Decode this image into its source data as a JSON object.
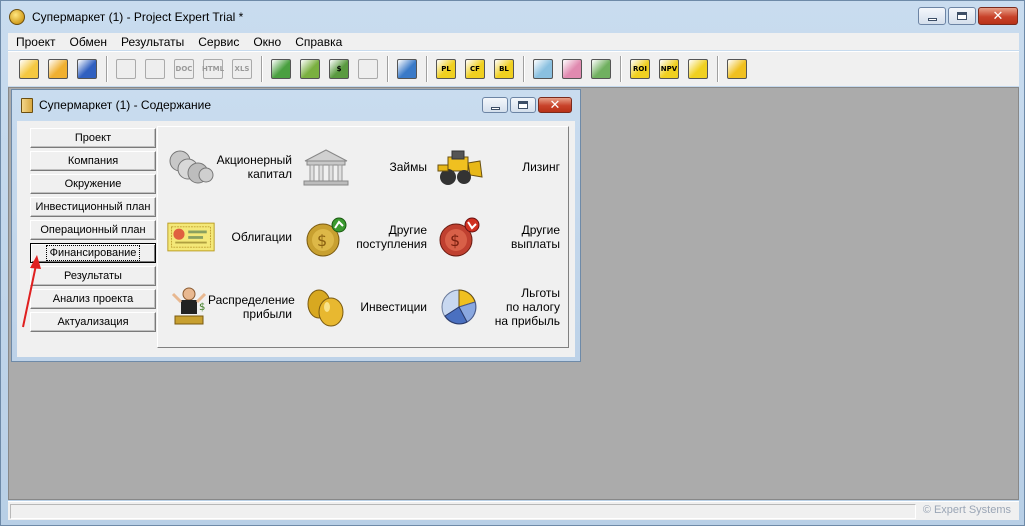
{
  "app": {
    "title": "Супермаркет (1) - Project Expert Trial *"
  },
  "menu": [
    "Проект",
    "Обмен",
    "Результаты",
    "Сервис",
    "Окно",
    "Справка"
  ],
  "toolbar": {
    "groups": [
      [
        {
          "icon": "new-project-icon",
          "text": "",
          "color": "#f5c840"
        },
        {
          "icon": "open-folder-icon",
          "text": "",
          "color": "#f0b030"
        },
        {
          "icon": "save-disk-icon",
          "text": "",
          "color": "#3060c0"
        }
      ],
      [
        {
          "icon": "print-preview-icon",
          "text": "",
          "disabled": true
        },
        {
          "icon": "print-icon",
          "text": "",
          "disabled": true
        },
        {
          "icon": "export-doc-icon",
          "text": "DOC",
          "disabled": true
        },
        {
          "icon": "export-html-icon",
          "text": "HTML",
          "disabled": true
        },
        {
          "icon": "export-xls-icon",
          "text": "XLS",
          "disabled": true
        }
      ],
      [
        {
          "icon": "tiles-icon",
          "text": "",
          "color": "#4aa040"
        },
        {
          "icon": "edit-pencil-icon",
          "text": "",
          "color": "#7ab040"
        },
        {
          "icon": "calculator-icon",
          "text": "$",
          "color": "#5a9a40"
        },
        {
          "icon": "table-icon",
          "text": "",
          "disabled": true
        }
      ],
      [
        {
          "icon": "refresh-project-icon",
          "text": "",
          "color": "#3a7ac8"
        }
      ],
      [
        {
          "icon": "pl-report-icon",
          "text": "PL",
          "color": "#f0d020"
        },
        {
          "icon": "cf-report-icon",
          "text": "CF",
          "color": "#f0d020"
        },
        {
          "icon": "bl-report-icon",
          "text": "BL",
          "color": "#f0d020"
        }
      ],
      [
        {
          "icon": "zoom-report-icon",
          "text": "",
          "color": "#8ac0e0"
        },
        {
          "icon": "user-profile-icon",
          "text": "",
          "color": "#e08ab0"
        },
        {
          "icon": "chart-image-icon",
          "text": "",
          "color": "#70b060"
        }
      ],
      [
        {
          "icon": "roi-icon",
          "text": "ROI",
          "color": "#f0d020"
        },
        {
          "icon": "npv-icon",
          "text": "NPV",
          "color": "#f0d020"
        },
        {
          "icon": "notepad-icon",
          "text": "",
          "color": "#f0d020"
        }
      ],
      [
        {
          "icon": "spreadsheet-icon",
          "text": "",
          "color": "#f0c020"
        }
      ]
    ]
  },
  "child": {
    "title": "Супермаркет (1) - Содержание",
    "nav": [
      {
        "label": "Проект",
        "active": false
      },
      {
        "label": "Компания",
        "active": false
      },
      {
        "label": "Окружение",
        "active": false
      },
      {
        "label": "Инвестиционный план",
        "active": false
      },
      {
        "label": "Операционный план",
        "active": false
      },
      {
        "label": "Финансирование",
        "active": true
      },
      {
        "label": "Результаты",
        "active": false
      },
      {
        "label": "Анализ проекта",
        "active": false
      },
      {
        "label": "Актуализация",
        "active": false
      }
    ],
    "tiles": [
      {
        "icon": "coins-stack-icon",
        "label": "Акционерный\nкапитал"
      },
      {
        "icon": "bank-building-icon",
        "label": "Займы"
      },
      {
        "icon": "bulldozer-icon",
        "label": "Лизинг"
      },
      {
        "icon": "bond-certificate-icon",
        "label": "Облигации"
      },
      {
        "icon": "coin-income-icon",
        "label": "Другие\nпоступления"
      },
      {
        "icon": "coin-outflow-icon",
        "label": "Другие\nвыплаты"
      },
      {
        "icon": "person-money-icon",
        "label": "Распределение\nприбыли"
      },
      {
        "icon": "golden-eggs-icon",
        "label": "Инвестиции"
      },
      {
        "icon": "pie-chart-icon",
        "label": "Льготы\nпо налогу\nна прибыль"
      }
    ]
  },
  "status": {
    "brand": "© Expert Systems"
  },
  "colors": {
    "window_frame": "#c9dcef",
    "mdi_background": "#ababab",
    "close_button": "#c8422a",
    "annotation_arrow": "#e02020"
  }
}
